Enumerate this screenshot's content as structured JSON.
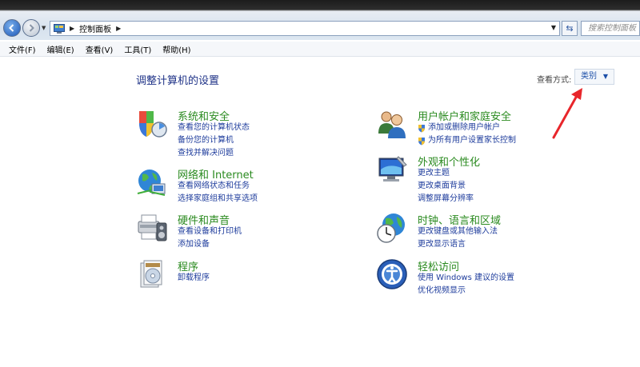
{
  "address": {
    "crumb": "控制面板",
    "search_placeholder": "搜索控制面板"
  },
  "menu": [
    "文件(F)",
    "编辑(E)",
    "查看(V)",
    "工具(T)",
    "帮助(H)"
  ],
  "page_title": "调整计算机的设置",
  "view": {
    "label": "查看方式:",
    "value": "类别"
  },
  "categories": [
    {
      "title": "系统和安全",
      "icon": "system-security-icon",
      "links": [
        "查看您的计算机状态",
        "备份您的计算机",
        "查找并解决问题"
      ]
    },
    {
      "title": "网络和 Internet",
      "icon": "network-icon",
      "links": [
        "查看网络状态和任务",
        "选择家庭组和共享选项"
      ]
    },
    {
      "title": "硬件和声音",
      "icon": "hardware-sound-icon",
      "links": [
        "查看设备和打印机",
        "添加设备"
      ]
    },
    {
      "title": "程序",
      "icon": "programs-icon",
      "links": [
        "卸载程序"
      ]
    },
    {
      "title": "用户帐户和家庭安全",
      "icon": "user-accounts-icon",
      "links": [
        "添加或删除用户帐户",
        "为所有用户设置家长控制"
      ]
    },
    {
      "title": "外观和个性化",
      "icon": "appearance-icon",
      "links": [
        "更改主题",
        "更改桌面背景",
        "调整屏幕分辨率"
      ]
    },
    {
      "title": "时钟、语言和区域",
      "icon": "clock-language-icon",
      "links": [
        "更改键盘或其他输入法",
        "更改显示语言"
      ]
    },
    {
      "title": "轻松访问",
      "icon": "ease-of-access-icon",
      "links": [
        "使用 Windows 建议的设置",
        "优化视频显示"
      ]
    }
  ],
  "colors": {
    "category_title": "#2a8a1f",
    "link": "#1e3c9c",
    "page_title": "#1e3287",
    "annotation_arrow": "#e8262b"
  }
}
